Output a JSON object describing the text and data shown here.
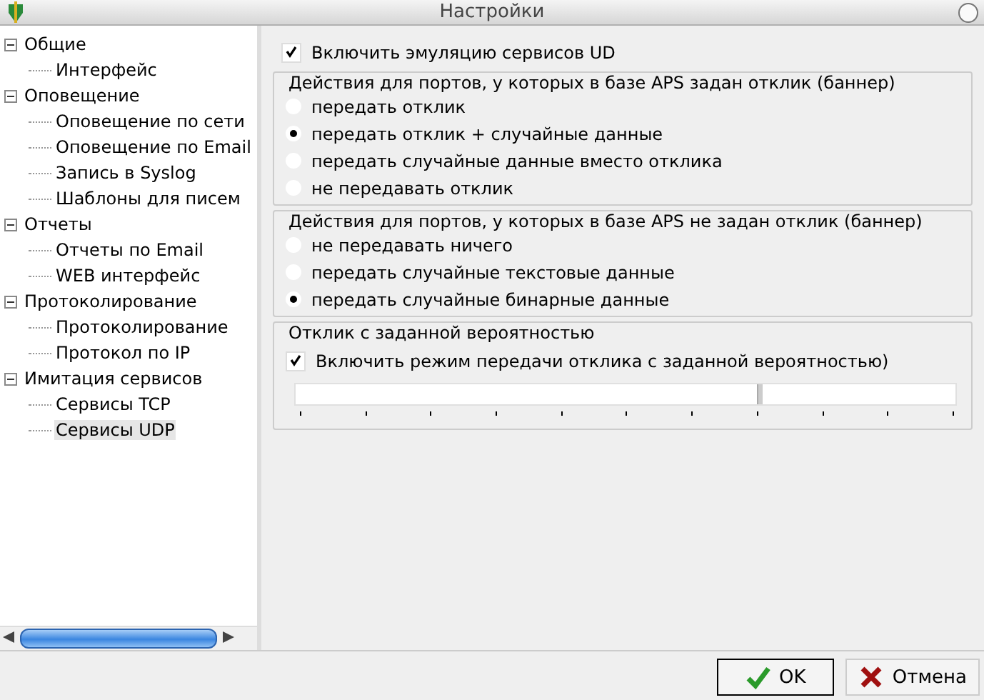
{
  "window": {
    "title": "Настройки"
  },
  "tree": [
    {
      "label": "Общие",
      "expanded": true,
      "selected": false,
      "children": [
        {
          "label": "Интерфейс",
          "selected": false
        }
      ]
    },
    {
      "label": "Оповещение",
      "expanded": true,
      "selected": false,
      "children": [
        {
          "label": "Оповещение по сети",
          "selected": false
        },
        {
          "label": "Оповещение по Email",
          "selected": false
        },
        {
          "label": "Запись в Syslog",
          "selected": false
        },
        {
          "label": "Шаблоны для писем",
          "selected": false
        }
      ]
    },
    {
      "label": "Отчеты",
      "expanded": true,
      "selected": false,
      "children": [
        {
          "label": "Отчеты по Email",
          "selected": false
        },
        {
          "label": "WEB интерфейс",
          "selected": false
        }
      ]
    },
    {
      "label": "Протоколирование",
      "expanded": true,
      "selected": false,
      "children": [
        {
          "label": "Протоколирование",
          "selected": false
        },
        {
          "label": "Протокол по IP",
          "selected": false
        }
      ]
    },
    {
      "label": "Имитация сервисов",
      "expanded": true,
      "selected": false,
      "children": [
        {
          "label": "Сервисы TCP",
          "selected": false
        },
        {
          "label": "Сервисы UDP",
          "selected": true
        }
      ]
    }
  ],
  "enable": {
    "label": "Включить эмуляцию сервисов UD",
    "checked": true
  },
  "groups": [
    {
      "title": "Действия для портов, у которых в базе APS задан отклик (баннер)",
      "options": [
        {
          "label": "передать отклик",
          "selected": false
        },
        {
          "label": "передать отклик + случайные данные",
          "selected": true
        },
        {
          "label": "передать случайные данные вместо отклика",
          "selected": false
        },
        {
          "label": "не передавать отклик",
          "selected": false
        }
      ]
    },
    {
      "title": "Действия для портов, у которых в базе APS не задан отклик (баннер)",
      "options": [
        {
          "label": "не передавать ничего",
          "selected": false
        },
        {
          "label": "передать случайные текстовые данные",
          "selected": false
        },
        {
          "label": "передать случайные бинарные данные",
          "selected": true
        }
      ]
    }
  ],
  "probability": {
    "title": "Отклик с заданной вероятностью",
    "checkbox": {
      "label": "Включить режим передачи отклика с заданной вероятностью)",
      "checked": true
    },
    "slider": {
      "level": 0.7
    }
  },
  "buttons": [
    {
      "label": "OK",
      "kind": "ok"
    },
    {
      "label": "Отмена",
      "kind": "cancel"
    }
  ]
}
